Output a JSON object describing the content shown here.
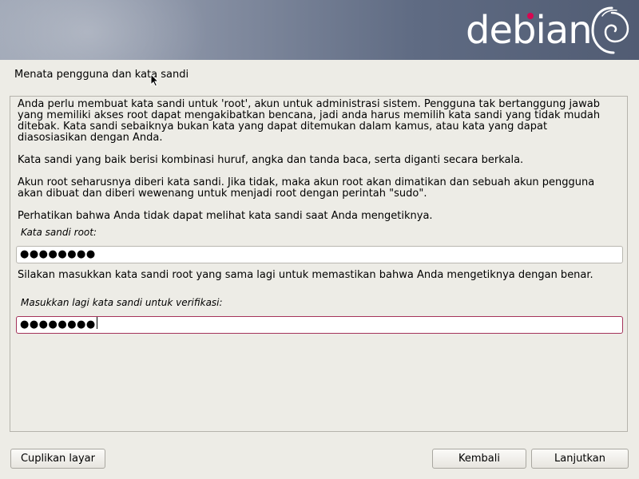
{
  "banner": {
    "wordmark": "debian"
  },
  "page": {
    "title": "Menata pengguna dan kata sandi"
  },
  "content": {
    "paragraphs": [
      "Anda perlu membuat kata sandi untuk 'root', akun untuk administrasi sistem. Pengguna tak bertanggung jawab yang memiliki akses root dapat mengakibatkan bencana, jadi anda harus memilih kata sandi yang tidak mudah ditebak. Kata sandi sebaiknya bukan kata yang dapat ditemukan dalam kamus, atau kata yang dapat diasosiasikan dengan Anda.",
      "Kata sandi yang baik berisi kombinasi huruf, angka dan tanda baca, serta diganti secara berkala.",
      "Akun root seharusnya diberi kata sandi. Jika tidak, maka akun root akan dimatikan dan sebuah akun pengguna akan dibuat dan diberi wewenang untuk menjadi root dengan perintah \"sudo\".",
      "Perhatikan bahwa Anda tidak dapat melihat kata sandi saat Anda mengetiknya."
    ],
    "root_password_label": "Kata sandi root:",
    "root_password_value": "●●●●●●●●",
    "verify_instruction": "Silakan masukkan kata sandi root yang sama lagi untuk memastikan bahwa Anda mengetiknya dengan benar.",
    "verify_label": "Masukkan lagi kata sandi untuk verifikasi:",
    "verify_password_value": "●●●●●●●●"
  },
  "buttons": {
    "screenshot": "Cuplikan layar",
    "back": "Kembali",
    "continue": "Lanjutkan"
  },
  "colors": {
    "accent": "#d70751",
    "focus_border": "#a4325a",
    "background": "#edece6"
  },
  "icons": [
    "debian-swirl-icon",
    "mouse-pointer-icon"
  ]
}
